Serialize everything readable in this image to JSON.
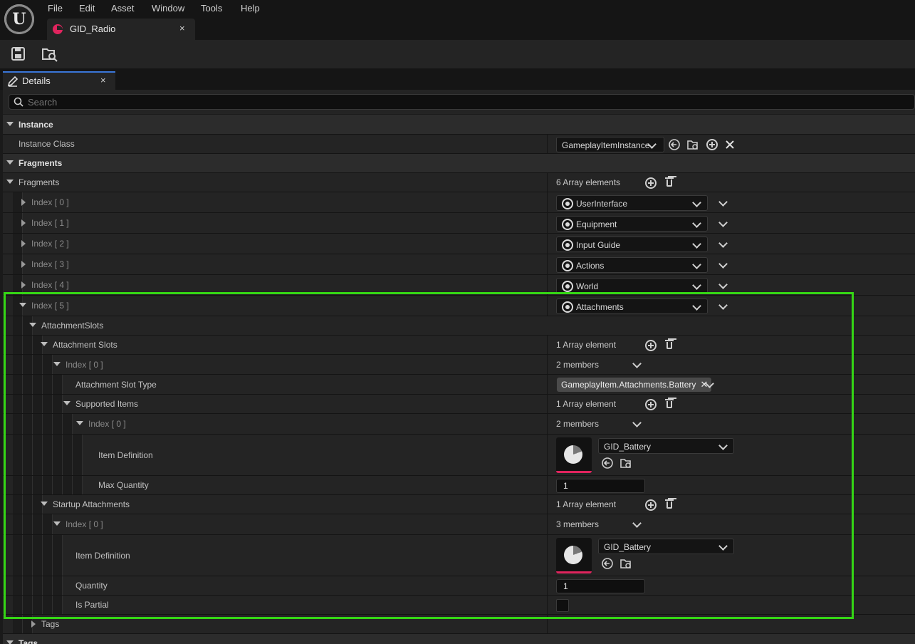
{
  "menu": [
    "File",
    "Edit",
    "Asset",
    "Window",
    "Tools",
    "Help"
  ],
  "asset_tab": {
    "label": "GID_Radio",
    "close": "×"
  },
  "details_tab": {
    "label": "Details",
    "close": "×"
  },
  "search": {
    "placeholder": "Search"
  },
  "colors": {
    "highlight": "#35d615",
    "asset_accent": "#e0245e",
    "tab_accent": "#3a76d8"
  },
  "icons": {
    "logo": "unreal-engine-logo",
    "save": "save-icon",
    "browse": "browse-to-asset-icon"
  },
  "rows": {
    "instance_cat": "Instance",
    "instance_class": {
      "label": "Instance Class",
      "value": "GameplayItemInstance"
    },
    "fragments_cat": "Fragments",
    "fragments": {
      "label": "Fragments",
      "value": "6 Array elements"
    },
    "idx0": {
      "label": "Index [ 0 ]",
      "value": "UserInterface"
    },
    "idx1": {
      "label": "Index [ 1 ]",
      "value": "Equipment"
    },
    "idx2": {
      "label": "Index [ 2 ]",
      "value": "Input Guide"
    },
    "idx3": {
      "label": "Index [ 3 ]",
      "value": "Actions"
    },
    "idx4": {
      "label": "Index [ 4 ]",
      "value": "World"
    },
    "idx5": {
      "label": "Index [ 5 ]",
      "value": "Attachments"
    },
    "attachment_slots_struct": "AttachmentSlots",
    "attachment_slots": {
      "label": "Attachment Slots",
      "value": "1 Array element"
    },
    "as_idx0": {
      "label": "Index [ 0 ]",
      "value": "2 members"
    },
    "slot_type": {
      "label": "Attachment Slot Type",
      "value": "GameplayItem.Attachments.Battery",
      "remove": "✕"
    },
    "supported_items": {
      "label": "Supported Items",
      "value": "1 Array element"
    },
    "si_idx0": {
      "label": "Index [ 0 ]",
      "value": "2 members"
    },
    "si_item_def": {
      "label": "Item Definition",
      "value": "GID_Battery"
    },
    "si_max_qty": {
      "label": "Max Quantity",
      "value": "1"
    },
    "startup": {
      "label": "Startup Attachments",
      "value": "1 Array element"
    },
    "st_idx0": {
      "label": "Index [ 0 ]",
      "value": "3 members"
    },
    "st_item_def": {
      "label": "Item Definition",
      "value": "GID_Battery"
    },
    "st_qty": {
      "label": "Quantity",
      "value": "1"
    },
    "st_partial": {
      "label": "Is Partial",
      "checked": false
    },
    "tags": {
      "label": "Tags"
    },
    "tags_cat": "Tags"
  }
}
